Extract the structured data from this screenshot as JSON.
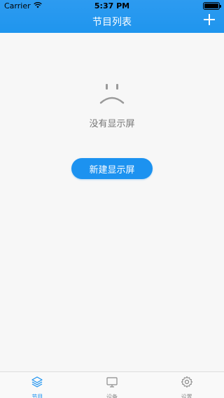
{
  "status_bar": {
    "carrier": "Carrier",
    "time": "5:37 PM"
  },
  "header": {
    "title": "节目列表",
    "add_icon": "plus-icon"
  },
  "empty_state": {
    "icon": "sad-face-icon",
    "message": "没有显示屏",
    "button_label": "新建显示屏"
  },
  "tabbar": {
    "items": [
      {
        "label": "节目",
        "icon": "layers-icon",
        "active": true
      },
      {
        "label": "设备",
        "icon": "monitor-icon",
        "active": false
      },
      {
        "label": "设置",
        "icon": "gear-icon",
        "active": false
      }
    ]
  },
  "colors": {
    "primary": "#1c92f0",
    "header": "#2d9bf0",
    "background": "#f7f7f7",
    "inactive": "#8a8a8a"
  }
}
